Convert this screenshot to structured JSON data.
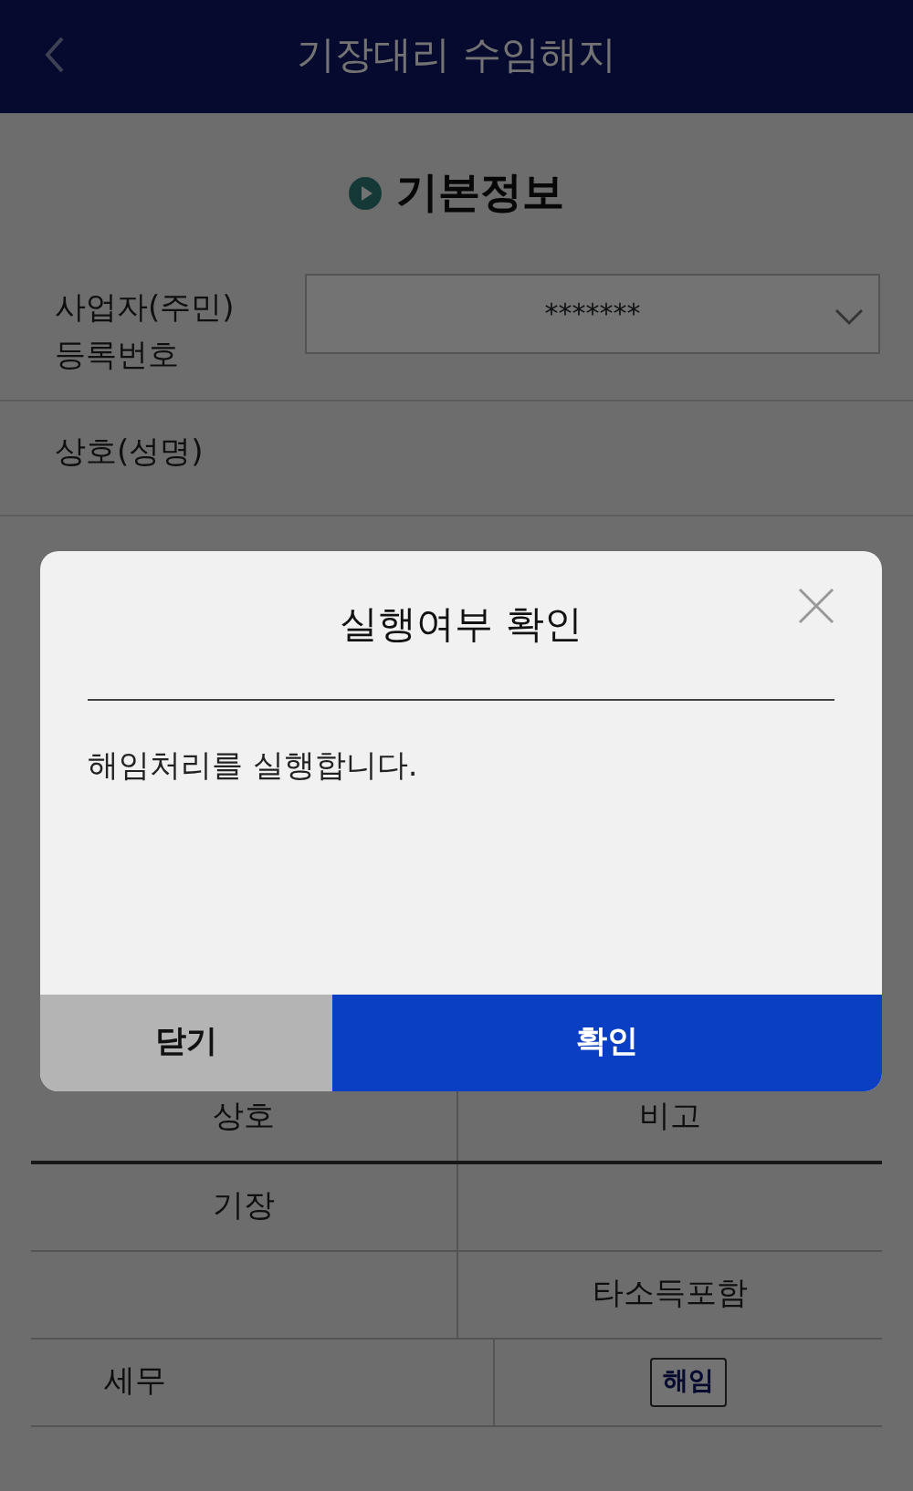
{
  "header": {
    "title": "기장대리 수임해지"
  },
  "section": {
    "title": "기본정보"
  },
  "form": [
    {
      "kind": "select",
      "label_lines": [
        "사업자(주민)",
        "등록번호"
      ],
      "value": "*******"
    },
    {
      "kind": "text",
      "label_lines": [
        "상호(성명)"
      ]
    }
  ],
  "table": {
    "columns": [
      "상호",
      "비고"
    ],
    "rows": [
      {
        "label": "기장"
      },
      {
        "note": "타소득포함"
      },
      {
        "label": "세무",
        "action": "해임"
      }
    ]
  },
  "dialog": {
    "title": "실행여부 확인",
    "message": "해임처리를 실행합니다.",
    "buttons": [
      {
        "label": "닫기",
        "kind": "secondary"
      },
      {
        "label": "확인",
        "kind": "primary"
      }
    ]
  }
}
